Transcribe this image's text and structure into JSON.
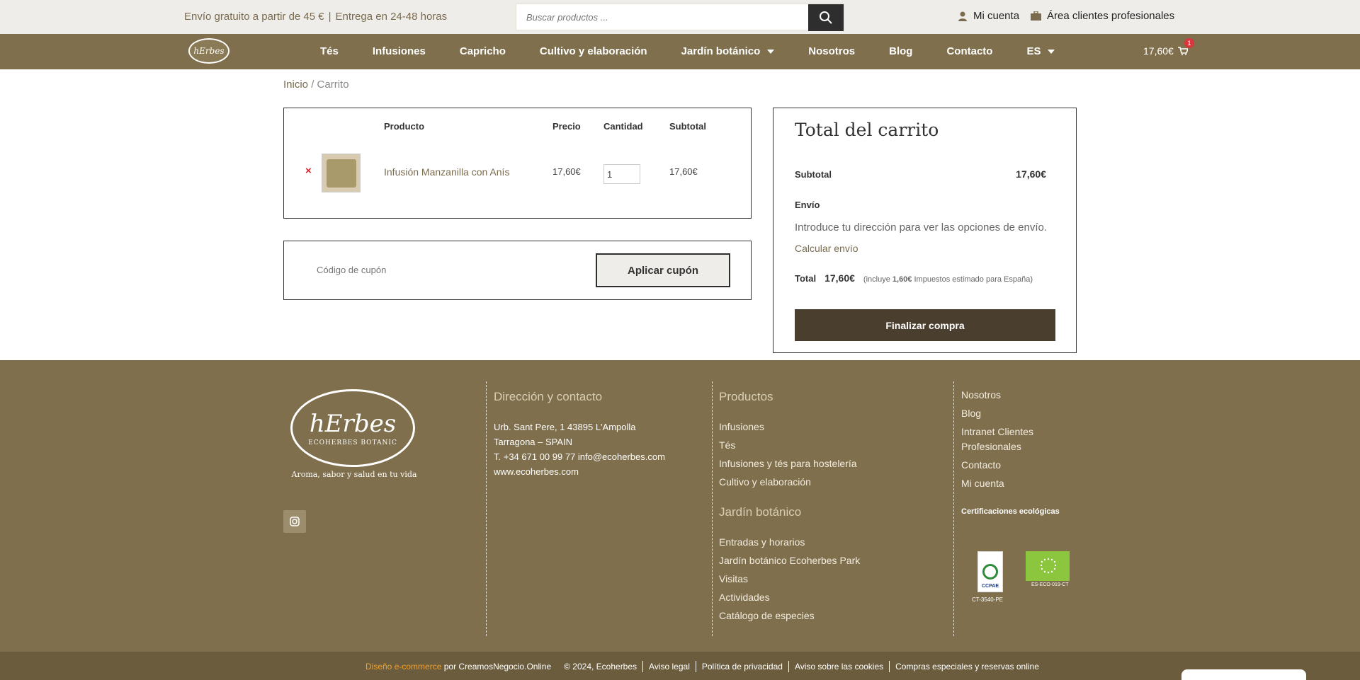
{
  "topbar": {
    "promo_shipping": "Envío gratuito a partir de 45 €",
    "promo_delivery": "Entrega en 24-48 horas",
    "search_placeholder": "Buscar productos ...",
    "my_account": "Mi cuenta",
    "pro_area": "Área clientes profesionales"
  },
  "nav": {
    "logo_text": "hErbes",
    "items": [
      "Tés",
      "Infusiones",
      "Capricho",
      "Cultivo y elaboración",
      "Jardín botánico",
      "Nosotros",
      "Blog",
      "Contacto",
      "ES"
    ],
    "cart_total": "17,60€",
    "cart_count": "1"
  },
  "breadcrumb": {
    "home": "Inicio",
    "separator": "/",
    "current": "Carrito"
  },
  "cart_table": {
    "headers": {
      "product": "Producto",
      "price": "Precio",
      "quantity": "Cantidad",
      "subtotal": "Subtotal"
    },
    "rows": [
      {
        "remove": "×",
        "name": "Infusión Manzanilla con Anís",
        "price": "17,60€",
        "quantity": "1",
        "subtotal": "17,60€"
      }
    ]
  },
  "coupon": {
    "placeholder": "Código de cupón",
    "button": "Aplicar cupón"
  },
  "totals": {
    "title": "Total del carrito",
    "subtotal_label": "Subtotal",
    "subtotal_value": "17,60€",
    "shipping_label": "Envío",
    "shipping_text": "Introduce tu dirección para ver las opciones de envío.",
    "calc_shipping": "Calcular envío",
    "total_label": "Total",
    "total_value": "17,60€",
    "tax_prefix": "(incluye",
    "tax_amount": "1,60€",
    "tax_suffix": "Impuestos estimado para España)",
    "checkout_button": "Finalizar compra"
  },
  "footer": {
    "logo_text": "hErbes",
    "logo_sub": "ECOHERBES BOTANIC",
    "slogan": "Aroma, sabor y salud en tu vida",
    "contact_title": "Dirección y contacto",
    "address1": "Urb. Sant Pere, 1 43895 L'Ampolla",
    "address2": "Tarragona – SPAIN",
    "phone_email": "T. +34 671 00 99 77 info@ecoherbes.com",
    "website": "www.ecoherbes.com",
    "products_title": "Productos",
    "products": [
      "Infusiones",
      "Tés",
      "Infusiones y tés para hostelería",
      "Cultivo y elaboración"
    ],
    "garden_title": "Jardín botánico",
    "garden": [
      "Entradas y horarios",
      "Jardín botánico Ecoherbes Park",
      "Visitas",
      "Actividades",
      "Catálogo de especies"
    ],
    "links": [
      "Nosotros",
      "Blog",
      "Intranet Clientes",
      "Profesionales",
      "Contacto",
      "Mi cuenta"
    ],
    "cert_title": "Certificaciones ecológicas",
    "cert1_label": "CCPAE",
    "cert1_code": "CT-3540-PE",
    "cert2_code": "ES-ECO-019-CT"
  },
  "bottombar": {
    "design": "Diseño e-commerce",
    "by": "por CreamosNegocio.Online",
    "copyright": "© 2024, Ecoherbes",
    "legal": "Aviso legal",
    "privacy": "Política de privacidad",
    "cookies": "Aviso sobre las cookies",
    "special": "Compras especiales y reservas online"
  }
}
